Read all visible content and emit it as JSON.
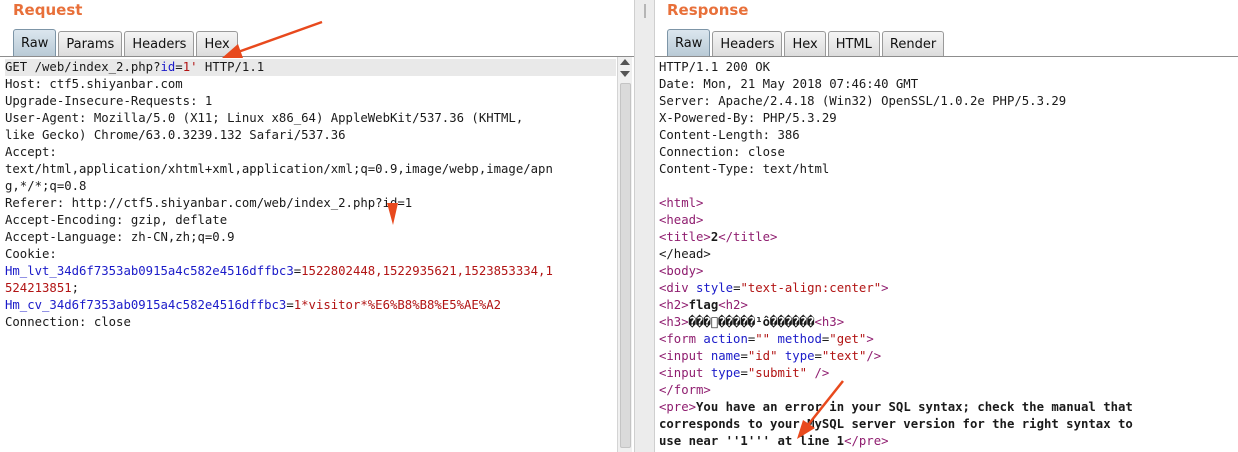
{
  "corner_glyph": "⇗",
  "request": {
    "title": "Request",
    "tabs": [
      "Raw",
      "Params",
      "Headers",
      "Hex"
    ],
    "active_tab": "Raw",
    "lines": {
      "l0_a": "GET /web/index_2.php?",
      "l0_k": "id",
      "l0_eq": "=",
      "l0_v": "1'",
      "l0_b": " HTTP/1.1",
      "l1": "Host: ctf5.shiyanbar.com",
      "l2": "Upgrade-Insecure-Requests: 1",
      "l3": "User-Agent: Mozilla/5.0 (X11; Linux x86_64) AppleWebKit/537.36 (KHTML,",
      "l4": "like Gecko) Chrome/63.0.3239.132 Safari/537.36",
      "l5": "Accept:",
      "l6": "text/html,application/xhtml+xml,application/xml;q=0.9,image/webp,image/apn",
      "l7": "g,*/*;q=0.8",
      "l8": "Referer: http://ctf5.shiyanbar.com/web/index_2.php?id=1",
      "l9": "Accept-Encoding: gzip, deflate",
      "l10": "Accept-Language: zh-CN,zh;q=0.9",
      "l11": "Cookie:",
      "l12_k": "Hm_lvt_34d6f7353ab0915a4c582e4516dffbc3",
      "l12_eq": "=",
      "l12_v": "1522802448,1522935621,1523853334,1",
      "l13_v": "524213851",
      "l13_semi": ";",
      "l14_k": "Hm_cv_34d6f7353ab0915a4c582e4516dffbc3",
      "l14_eq": "=",
      "l14_v": "1*visitor*%E6%B8%B8%E5%AE%A2",
      "l15": "Connection: close"
    }
  },
  "response": {
    "title": "Response",
    "tabs": [
      "Raw",
      "Headers",
      "Hex",
      "HTML",
      "Render"
    ],
    "active_tab": "Raw",
    "lines": {
      "h0": "HTTP/1.1 200 OK",
      "h1": "Date: Mon, 21 May 2018 07:46:40 GMT",
      "h2": "Server: Apache/2.4.18 (Win32) OpenSSL/1.0.2e PHP/5.3.29",
      "h3": "X-Powered-By: PHP/5.3.29",
      "h4": "Content-Length: 386",
      "h5": "Connection: close",
      "h6": "Content-Type: text/html",
      "b_html": "<html>",
      "b_head": "<head>",
      "b_title_open": "<title>",
      "b_title_text": "2",
      "b_title_close": "</title>",
      "b_head_close": "</head>",
      "b_body": "<body>",
      "b_div_open": "<div ",
      "b_div_attr": "style",
      "b_div_eq": "=",
      "b_div_val": "\"text-align:center\"",
      "b_div_end": ">",
      "b_h2_open": "<h2>",
      "b_h2_text": "flag",
      "b_h2_close": "<h2>",
      "b_h3_open": "<h3>",
      "b_h3_text": "���\u0000�����¹ô������",
      "b_h3_close": "<h3>",
      "b_form_open": "<form ",
      "b_form_a1": "action",
      "b_form_v1": "\"\"",
      "b_form_a2": "method",
      "b_form_v2": "\"get\"",
      "b_form_end": ">",
      "b_in1_open": "<input ",
      "b_in1_a1": "name",
      "b_in1_v1": "\"id\"",
      "b_in1_a2": "type",
      "b_in1_v2": "\"text\"",
      "b_in1_end": "/>",
      "b_in2_open": "<input ",
      "b_in2_a1": "type",
      "b_in2_v1": "\"submit\"",
      "b_in2_end": " />",
      "b_form_close": "</form>",
      "b_pre_open": "<pre>",
      "b_pre_t1": "You have an error in your SQL syntax; check the manual that",
      "b_pre_t2": "corresponds to your MySQL server version for the right syntax to",
      "b_pre_t3": "use near ''1''' at line 1",
      "b_pre_close": "</pre>"
    }
  },
  "colors": {
    "title": "#e8703a",
    "annotation_arrow": "#e8491d",
    "key": "#1b1bc9",
    "value": "#b21414",
    "tag": "#8f1d6f"
  }
}
